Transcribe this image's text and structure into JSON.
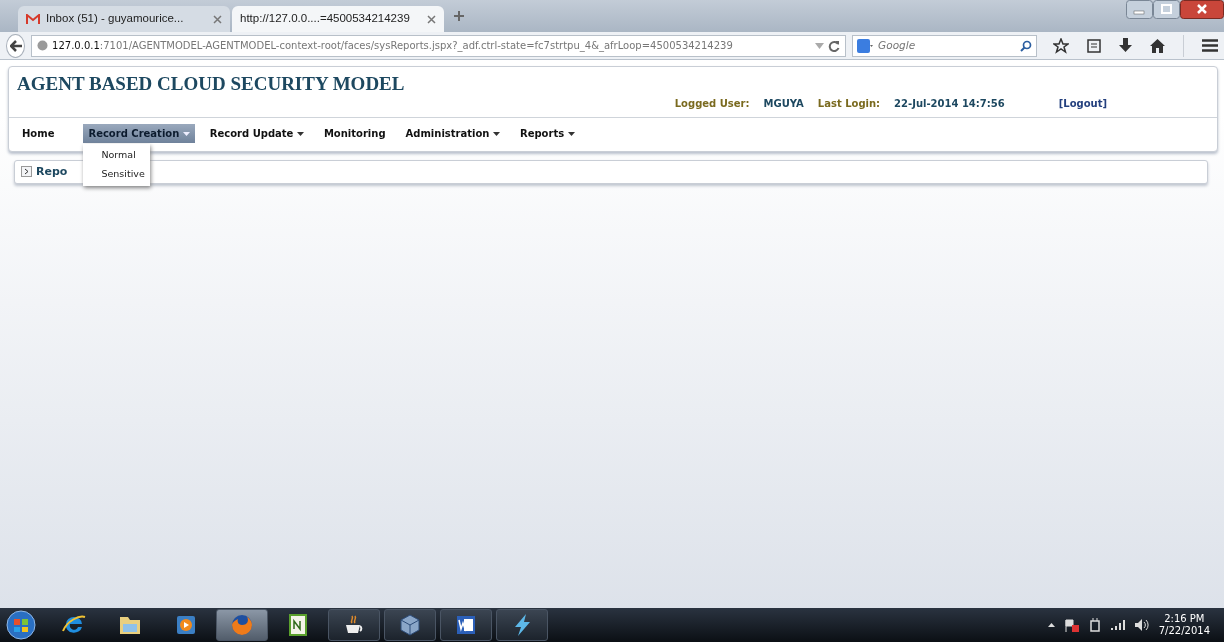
{
  "browser": {
    "tabs": [
      {
        "title": "Inbox (51) - guyamourice...",
        "kind": "mail",
        "selected": false
      },
      {
        "title": "http://127.0.0....=4500534214239",
        "kind": "page",
        "selected": true
      }
    ],
    "address": {
      "host": "127.0.0.1",
      "rest": ":7101/AGENTMODEL-AGENTMODEL-context-root/faces/sysReports.jspx?_adf.ctrl-state=fc7strtpu_4&_afrLoop=4500534214239"
    },
    "search": {
      "placeholder": "Google"
    }
  },
  "page": {
    "title": "AGENT BASED CLOUD SECURITY MODEL",
    "session": {
      "user_label": "Logged User:",
      "user": "MGUYA",
      "login_label": "Last Login:",
      "login": "22-Jul-2014 14:7:56",
      "logout": "[Logout]"
    },
    "menu": [
      {
        "label": "Home",
        "dropdown": false,
        "selected": false
      },
      {
        "label": "Record Creation",
        "dropdown": true,
        "selected": true
      },
      {
        "label": "Record Update",
        "dropdown": true,
        "selected": false
      },
      {
        "label": "Monitoring",
        "dropdown": false,
        "selected": false
      },
      {
        "label": "Administration",
        "dropdown": true,
        "selected": false
      },
      {
        "label": "Reports",
        "dropdown": true,
        "selected": false
      }
    ],
    "open_menu": [
      "Normal",
      "Sensitive"
    ],
    "panel": {
      "title": "Repo",
      "expanded": false
    }
  },
  "taskbar": {
    "apps": [
      {
        "kind": "ie",
        "running": false,
        "selected": false
      },
      {
        "kind": "folder",
        "running": false,
        "selected": false
      },
      {
        "kind": "media",
        "running": false,
        "selected": false
      },
      {
        "kind": "firefox",
        "running": true,
        "selected": true
      },
      {
        "kind": "notepad",
        "running": false,
        "selected": false
      },
      {
        "kind": "cup",
        "running": true,
        "selected": false
      },
      {
        "kind": "box",
        "running": true,
        "selected": false
      },
      {
        "kind": "word",
        "running": true,
        "selected": false
      },
      {
        "kind": "bolt",
        "running": true,
        "selected": false
      }
    ],
    "time": "2:16 PM",
    "date": "7/22/2014"
  }
}
